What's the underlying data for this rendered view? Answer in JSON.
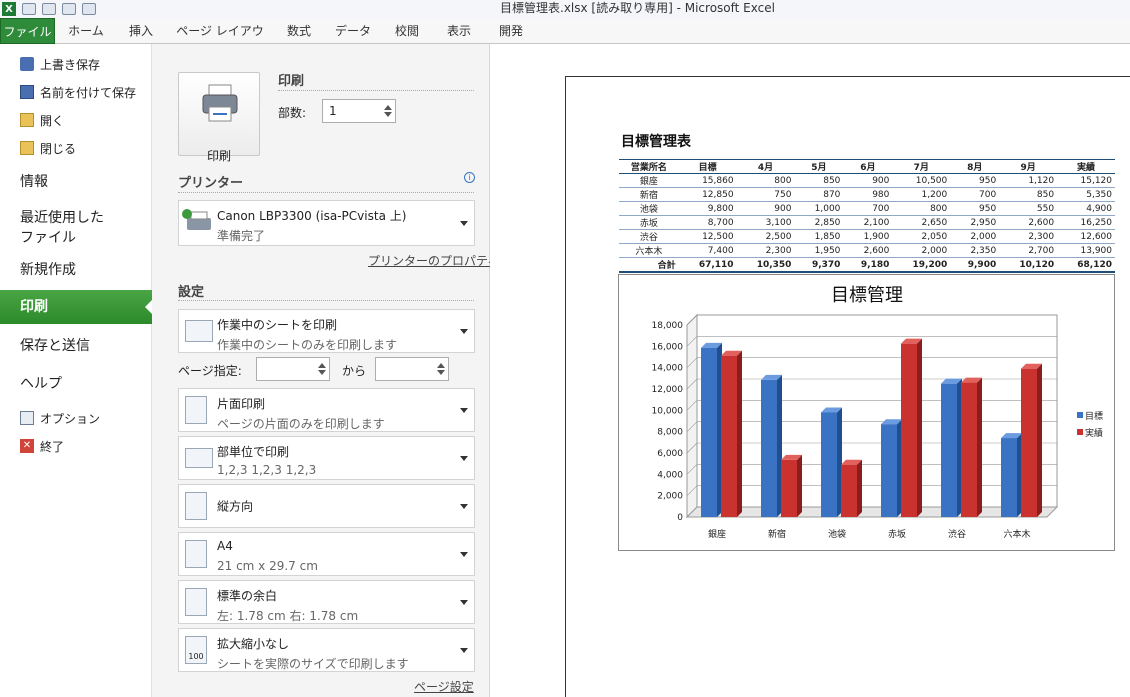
{
  "window": {
    "title": "目標管理表.xlsx  [読み取り専用]  -  Microsoft Excel"
  },
  "ribbon_tabs": [
    "ファイル",
    "ホーム",
    "挿入",
    "ページ レイアウト",
    "数式",
    "データ",
    "校閲",
    "表示",
    "開発"
  ],
  "backstage_nav": {
    "save": "上書き保存",
    "save_as": "名前を付けて保存",
    "open": "開く",
    "close": "閉じる",
    "info": "情報",
    "recent_1": "最近使用した",
    "recent_2": "ファイル",
    "new": "新規作成",
    "print": "印刷",
    "save_send": "保存と送信",
    "help": "ヘルプ",
    "options": "オプション",
    "exit": "終了"
  },
  "print_panel": {
    "print_button": "印刷",
    "print_heading": "印刷",
    "copies_label": "部数:",
    "copies_value": "1",
    "printer_heading": "プリンター",
    "printer_name": "Canon LBP3300 (isa-PCvista 上)",
    "printer_status": "準備完了",
    "printer_props_link": "プリンターのプロパティ",
    "settings_heading": "設定",
    "scope_main": "作業中のシートを印刷",
    "scope_sub": "作業中のシートのみを印刷します",
    "pages_label": "ページ指定:",
    "pages_to_label": "から",
    "sides_main": "片面印刷",
    "sides_sub": "ページの片面のみを印刷します",
    "collate_main": "部単位で印刷",
    "collate_sub": "1,2,3    1,2,3    1,2,3",
    "orientation": "縦方向",
    "paper_main": "A4",
    "paper_sub": "21 cm x 29.7 cm",
    "margins_main": "標準の余白",
    "margins_sub": "左:  1.78 cm    右:  1.78 cm",
    "scaling_main": "拡大縮小なし",
    "scaling_sub": "シートを実際のサイズで印刷します",
    "page_setup_link": "ページ設定"
  },
  "sheet": {
    "title": "目標管理表",
    "headers": [
      "営業所名",
      "目標",
      "4月",
      "5月",
      "6月",
      "7月",
      "8月",
      "9月",
      "実績"
    ],
    "rows": [
      [
        "銀座",
        "15,860",
        "800",
        "850",
        "900",
        "10,500",
        "950",
        "1,120",
        "15,120"
      ],
      [
        "新宿",
        "12,850",
        "750",
        "870",
        "980",
        "1,200",
        "700",
        "850",
        "5,350"
      ],
      [
        "池袋",
        "9,800",
        "900",
        "1,000",
        "700",
        "800",
        "950",
        "550",
        "4,900"
      ],
      [
        "赤坂",
        "8,700",
        "3,100",
        "2,850",
        "2,100",
        "2,650",
        "2,950",
        "2,600",
        "16,250"
      ],
      [
        "渋谷",
        "12,500",
        "2,500",
        "1,850",
        "1,900",
        "2,050",
        "2,000",
        "2,300",
        "12,600"
      ],
      [
        "六本木",
        "7,400",
        "2,300",
        "1,950",
        "2,600",
        "2,000",
        "2,350",
        "2,700",
        "13,900"
      ]
    ],
    "total": [
      "合計",
      "67,110",
      "10,350",
      "9,370",
      "9,180",
      "19,200",
      "9,900",
      "10,120",
      "68,120"
    ]
  },
  "chart_data": {
    "type": "bar",
    "title": "目標管理",
    "categories": [
      "銀座",
      "新宿",
      "池袋",
      "赤坂",
      "渋谷",
      "六本木"
    ],
    "series": [
      {
        "name": "目標",
        "values": [
          15860,
          12850,
          9800,
          8700,
          12500,
          7400
        ],
        "color": "#3b73c4"
      },
      {
        "name": "実績",
        "values": [
          15120,
          5350,
          4900,
          16250,
          12600,
          13900
        ],
        "color": "#c9322f"
      }
    ],
    "ylim": [
      0,
      18000
    ],
    "yticks": [
      "0",
      "2,000",
      "4,000",
      "6,000",
      "8,000",
      "10,000",
      "12,000",
      "14,000",
      "16,000",
      "18,000"
    ],
    "legend": "right",
    "grid": true
  }
}
